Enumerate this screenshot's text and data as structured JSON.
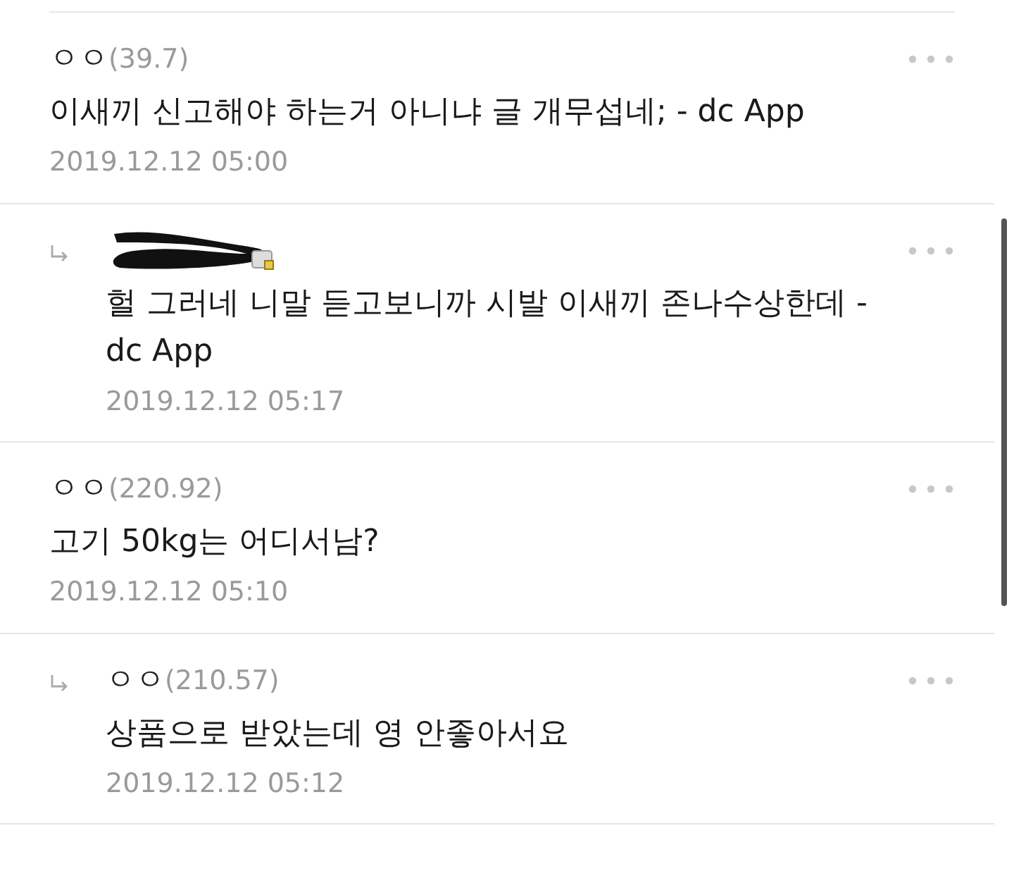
{
  "comments": [
    {
      "kind": "comment",
      "redacted": false,
      "name": "ㅇㅇ",
      "score": "(39.7)",
      "body": "이새끼 신고해야 하는거 아니냐 글 개무섭네; - dc App",
      "date": "2019.12.12 05:00"
    },
    {
      "kind": "reply",
      "redacted": true,
      "body": "헐 그러네 니말 듣고보니까 시발 이새끼 존나수상한데 - dc App",
      "date": "2019.12.12 05:17"
    },
    {
      "kind": "comment",
      "redacted": false,
      "name": "ㅇㅇ",
      "score": "(220.92)",
      "body": "고기 50kg는 어디서남?",
      "date": "2019.12.12 05:10"
    },
    {
      "kind": "reply",
      "redacted": false,
      "name": "ㅇㅇ",
      "score": "(210.57)",
      "body": "상품으로 받았는데 영 안좋아서요",
      "date": "2019.12.12 05:12"
    }
  ]
}
